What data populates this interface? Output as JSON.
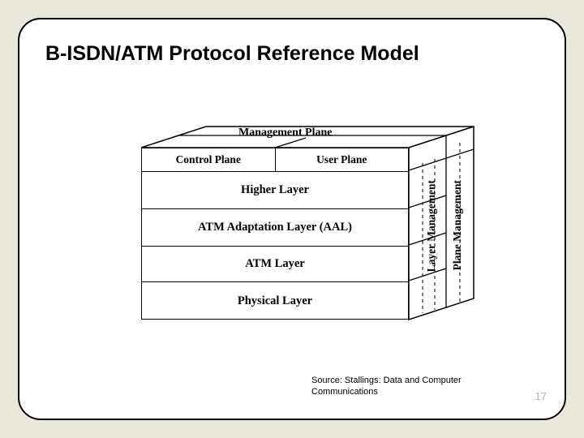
{
  "slide": {
    "title": "B-ISDN/ATM Protocol Reference Model",
    "source": "Source:  Stallings:  Data and Computer Communications",
    "page_number": "17"
  },
  "diagram": {
    "top_face": "Management Plane",
    "planes": {
      "control": "Control Plane",
      "user": "User Plane"
    },
    "layers": {
      "higher": "Higher Layer",
      "aal": "ATM Adaptation Layer (AAL)",
      "atm": "ATM Layer",
      "physical": "Physical Layer"
    },
    "side": {
      "layer_mgmt": "Layer Management",
      "plane_mgmt": "Plane Management"
    }
  }
}
